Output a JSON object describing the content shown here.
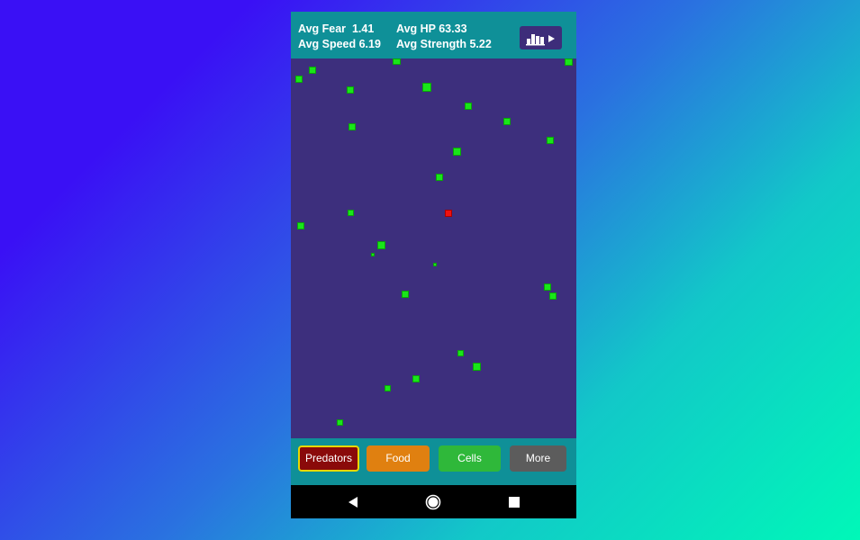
{
  "stats": {
    "avg_fear": "Avg Fear  1.41",
    "avg_hp": "Avg HP 63.33",
    "avg_speed": "Avg Speed 6.19",
    "avg_strength": "Avg Strength 5.22"
  },
  "stats_button_icon": "bar-chart-play-icon",
  "buttons": {
    "predators": "Predators",
    "food": "Food",
    "cells": "Cells",
    "more": "More"
  },
  "colors": {
    "teal_bar": "#0f9098",
    "canvas": "#3d2f7d",
    "cell_green": "#19e619",
    "predator_red": "#ee1111",
    "predators_button": "#8a0a0a",
    "predators_button_border": "#e8d800",
    "food_button": "#e08010",
    "cells_button": "#2fb83a",
    "more_button": "#5c5c5c"
  },
  "nav_icons": [
    "back-icon",
    "home-icon",
    "recents-icon"
  ]
}
